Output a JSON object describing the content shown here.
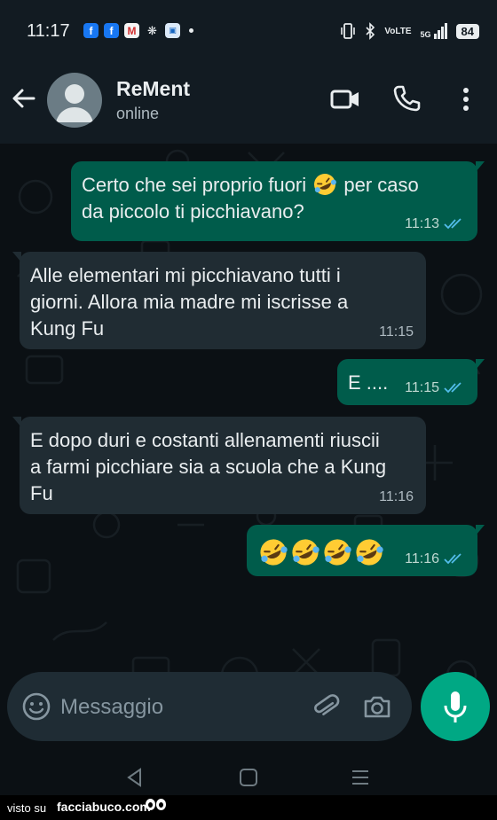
{
  "status_bar": {
    "time": "11:17",
    "notification_icons": [
      "facebook-icon",
      "facebook-icon",
      "mcdonalds-icon",
      "bug-icon",
      "calendar-icon"
    ],
    "network_label": "VoLTE",
    "signal_label": "5G",
    "battery": "84"
  },
  "header": {
    "contact_name": "ReMent",
    "status": "online"
  },
  "messages": [
    {
      "direction": "out",
      "text_a": "Certo che sei proprio fuori",
      "emoji": "rolling-on-floor-laughing",
      "text_b": "per caso",
      "text_c": "da piccolo ti picchiavano?",
      "time": "11:13",
      "read": true
    },
    {
      "direction": "in",
      "text": "Alle elementari mi picchiavano tutti i giorni. Allora mia madre mi iscrisse a Kung Fu",
      "time": "11:15"
    },
    {
      "direction": "out",
      "text": "E ....",
      "time": "11:15",
      "read": true
    },
    {
      "direction": "in",
      "text": "E dopo duri e costanti allenamenti riuscii a farmi picchiare sia a scuola che a Kung Fu",
      "time": "11:16"
    },
    {
      "direction": "out",
      "emojis": [
        "rolling-on-floor-laughing",
        "rolling-on-floor-laughing",
        "rolling-on-floor-laughing",
        "rolling-on-floor-laughing"
      ],
      "time": "11:16",
      "read": true
    }
  ],
  "composer": {
    "placeholder": "Messaggio"
  },
  "watermark": {
    "prefix": "visto su",
    "site": "facciabuco.com"
  },
  "colors": {
    "outgoing_bubble": "#005c4b",
    "incoming_bubble": "#202c33",
    "accent": "#00a884",
    "read_ticks": "#53bdeb"
  }
}
